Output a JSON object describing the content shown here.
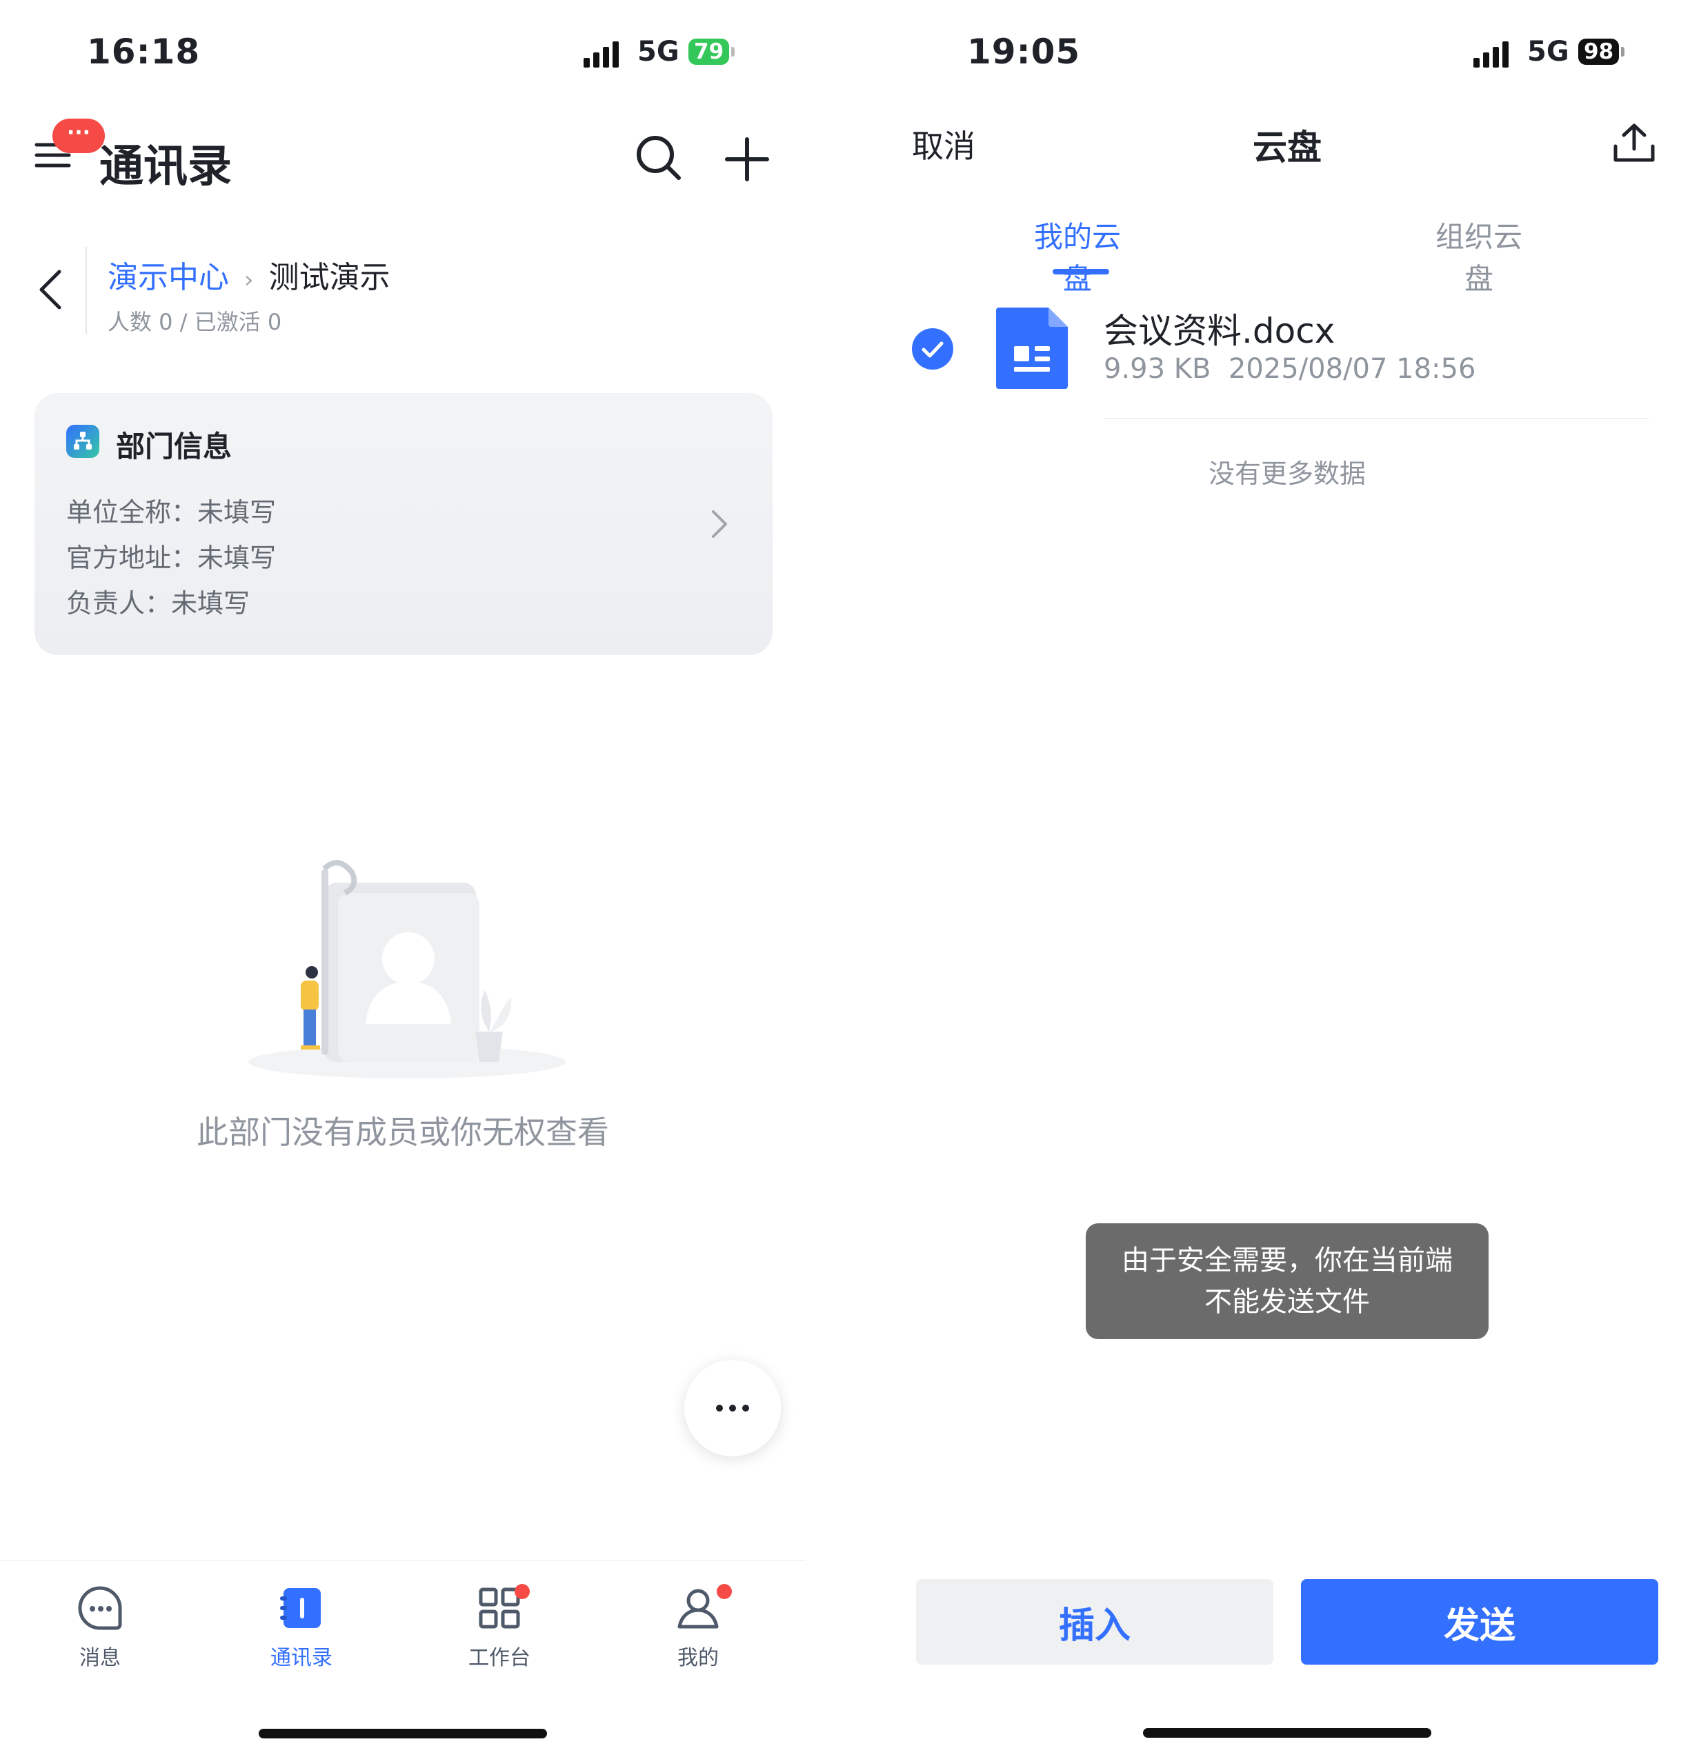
{
  "left": {
    "status": {
      "time": "16:18",
      "network": "5G",
      "battery": "79"
    },
    "header": {
      "title": "通讯录",
      "menu_badge": "···"
    },
    "breadcrumb": {
      "parent": "演示中心",
      "current": "测试演示",
      "sub": "人数 0 / 已激活 0"
    },
    "dept_card": {
      "title": "部门信息",
      "fields": [
        {
          "label": "单位全称：",
          "value": "未填写"
        },
        {
          "label": "官方地址：",
          "value": "未填写"
        },
        {
          "label": "负责人：",
          "value": "未填写"
        }
      ]
    },
    "empty_text": "此部门没有成员或你无权查看",
    "fab_icon": "more-dots-icon",
    "tabs": [
      {
        "label": "消息",
        "icon": "message-icon"
      },
      {
        "label": "通讯录",
        "icon": "contacts-icon"
      },
      {
        "label": "工作台",
        "icon": "workspace-icon"
      },
      {
        "label": "我的",
        "icon": "profile-icon"
      }
    ]
  },
  "right": {
    "status": {
      "time": "19:05",
      "network": "5G",
      "battery": "98"
    },
    "header": {
      "cancel": "取消",
      "title": "云盘"
    },
    "tabs": [
      "我的云盘",
      "组织云盘"
    ],
    "file": {
      "name": "会议资料.docx",
      "size": "9.93 KB",
      "date": "2025/08/07 18:56"
    },
    "no_more": "没有更多数据",
    "toast": {
      "line1": "由于安全需要，你在当前端",
      "line2": "不能发送文件"
    },
    "buttons": {
      "insert": "插入",
      "send": "发送"
    }
  },
  "colors": {
    "accent": "#3370ff",
    "battery_left": "#34c759",
    "badge": "#f54a45",
    "toast_bg": "#6b6b6b"
  }
}
